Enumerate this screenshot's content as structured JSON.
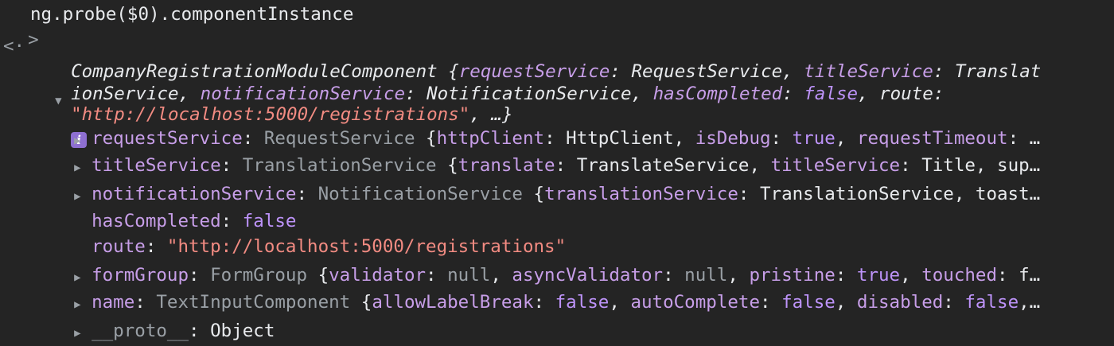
{
  "console": {
    "input_prompt": ">",
    "input_text": "ng.probe($0).componentInstance",
    "result_prompt": "<·",
    "summary_line1": "CompanyRegistrationModuleComponent {requestService: RequestService, titleService: Translat",
    "summary_line2": "ionService, notificationService: NotificationService, hasCompleted: false, route:",
    "summary_line3_str": "\"http://localhost:5000/registrations\"",
    "summary_line3_rest": ", …}",
    "info_badge": "i",
    "props": [
      {
        "key": "requestService",
        "cls": "RequestService",
        "body": "{httpClient: HttpClient, isDebug: true, requestTimeout: …"
      },
      {
        "key": "titleService",
        "cls": "TranslationService",
        "body": "{translate: TranslateService, titleService: Title, sup…"
      },
      {
        "key": "notificationService",
        "cls": "NotificationService",
        "body": "{translationService: TranslationService, toast…"
      },
      {
        "key": "hasCompleted",
        "value": "false"
      },
      {
        "key": "route",
        "value": "\"http://localhost:5000/registrations\""
      },
      {
        "key": "formGroup",
        "cls": "FormGroup",
        "body": "{validator: null, asyncValidator: null, pristine: true, touched: f…"
      },
      {
        "key": "name",
        "cls": "TextInputComponent",
        "body": "{allowLabelBreak: false, autoComplete: false, disabled: false,…"
      },
      {
        "key": "__proto__",
        "value": "Object"
      }
    ]
  }
}
